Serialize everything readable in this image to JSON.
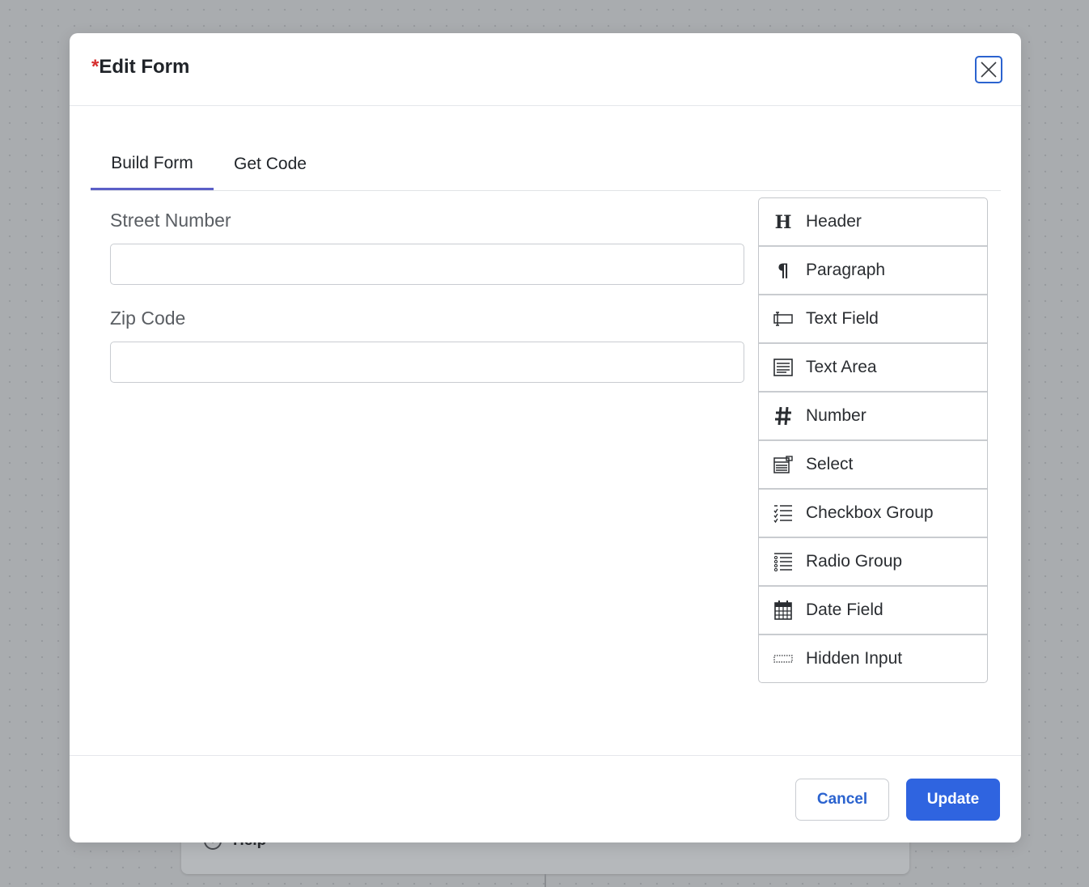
{
  "background": {
    "help_label": "Help"
  },
  "modal": {
    "required_mark": "*",
    "title": "Edit Form"
  },
  "tabs": [
    {
      "label": "Build Form",
      "active": true
    },
    {
      "label": "Get Code",
      "active": false
    }
  ],
  "form": {
    "fields": [
      {
        "label": "Street Number",
        "value": ""
      },
      {
        "label": "Zip Code",
        "value": ""
      }
    ]
  },
  "controls": [
    {
      "label": "Header",
      "icon": "header-icon"
    },
    {
      "label": "Paragraph",
      "icon": "paragraph-icon"
    },
    {
      "label": "Text Field",
      "icon": "text-field-icon"
    },
    {
      "label": "Text Area",
      "icon": "text-area-icon"
    },
    {
      "label": "Number",
      "icon": "number-icon"
    },
    {
      "label": "Select",
      "icon": "select-icon"
    },
    {
      "label": "Checkbox Group",
      "icon": "checkbox-group-icon"
    },
    {
      "label": "Radio Group",
      "icon": "radio-group-icon"
    },
    {
      "label": "Date Field",
      "icon": "date-field-icon"
    },
    {
      "label": "Hidden Input",
      "icon": "hidden-input-icon"
    }
  ],
  "footer": {
    "cancel_label": "Cancel",
    "update_label": "Update"
  },
  "colors": {
    "accent": "#2f64e0",
    "tab_indicator": "#5b5fc7",
    "required": "#d62e2e"
  }
}
